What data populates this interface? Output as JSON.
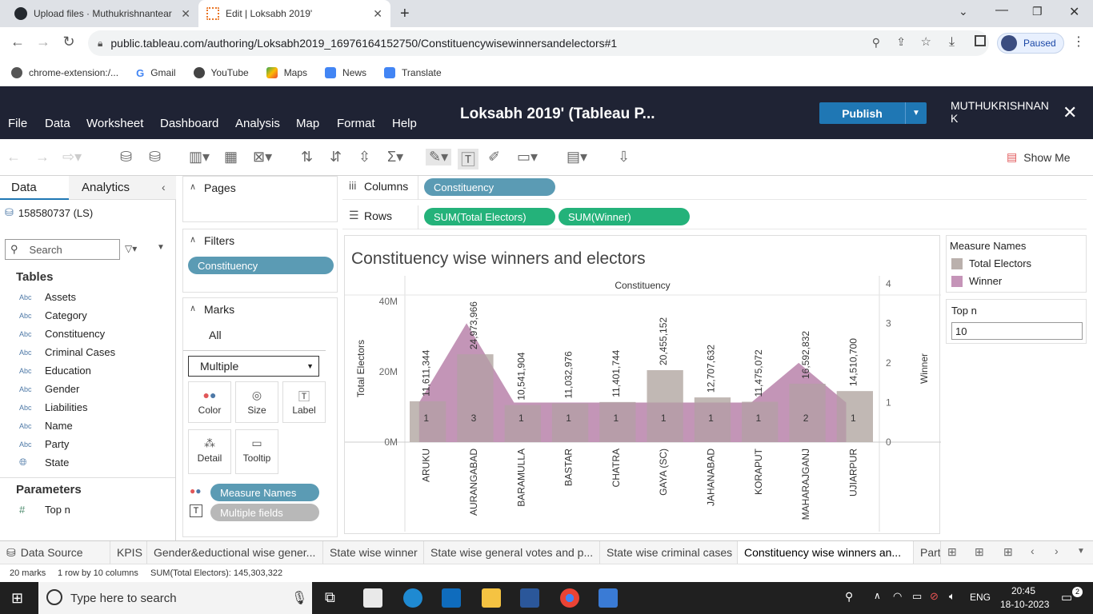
{
  "browser": {
    "tabs": [
      {
        "title": "Upload files · Muthukrishnantear",
        "active": false
      },
      {
        "title": "Edit | Loksabh 2019'",
        "active": true
      }
    ],
    "url": "public.tableau.com/authoring/Loksabh2019_16976164152750/Constituencywisewinnersandelectors#1",
    "profile_status": "Paused",
    "bookmarks": [
      "chrome-extension:/...",
      "Gmail",
      "YouTube",
      "Maps",
      "News",
      "Translate"
    ]
  },
  "tableau": {
    "menu": [
      "File",
      "Data",
      "Worksheet",
      "Dashboard",
      "Analysis",
      "Map",
      "Format",
      "Help"
    ],
    "workbook_title": "Loksabh 2019' (Tableau P...",
    "publish_label": "Publish",
    "user_line1": "MUTHUKRISHNAN",
    "user_line2": "K",
    "show_me": "Show Me"
  },
  "datapane": {
    "tab_data": "Data",
    "tab_analytics": "Analytics",
    "datasource": "158580737 (LS)",
    "search_placeholder": "Search",
    "tables_heading": "Tables",
    "type_abc": "Abc",
    "fields": [
      "Assets",
      "Category",
      "Constituency",
      "Criminal Cases",
      "Education",
      "Gender",
      "Liabilities",
      "Name",
      "Party",
      "State"
    ],
    "parameters_heading": "Parameters",
    "parameters": [
      "Top n"
    ]
  },
  "shelves": {
    "pages": "Pages",
    "filters": "Filters",
    "filter_pill": "Constituency",
    "marks": "Marks",
    "marks_all": "All",
    "mark_type": "Multiple",
    "mark_buttons": [
      "Color",
      "Size",
      "Label",
      "Detail",
      "Tooltip"
    ],
    "mark_pill_1": "Measure Names",
    "mark_pill_2": "Multiple fields",
    "columns_label": "Columns",
    "rows_label": "Rows",
    "columns_pill": "Constituency",
    "rows_pills": [
      "SUM(Total Electors)",
      "SUM(Winner)"
    ]
  },
  "legend": {
    "title": "Measure Names",
    "items": [
      {
        "label": "Total Electors",
        "color": "#bab0ac"
      },
      {
        "label": "Winner",
        "color": "#c594b8"
      }
    ]
  },
  "parameter_card": {
    "title": "Top n",
    "value": "10"
  },
  "chart_data": {
    "type": "bar",
    "title": "Constituency wise winners and electors",
    "xlabel": "Constituency",
    "ylabel": "Total Electors",
    "y2label": "Winner",
    "categories": [
      "ARUKU",
      "AURANGABAD",
      "BARAMULLA",
      "BASTAR",
      "CHATRA",
      "GAYA (SC)",
      "JAHANABAD",
      "KORAPUT",
      "MAHARAJGANJ",
      "UJIARPUR"
    ],
    "y_ticks": [
      "40M",
      "20M",
      "0M"
    ],
    "y2_ticks": [
      "4",
      "3",
      "2",
      "1",
      "0"
    ],
    "ylim": [
      0,
      45000000
    ],
    "y2lim": [
      0,
      4.4
    ],
    "series": [
      {
        "name": "Total Electors",
        "type": "bar",
        "values": [
          11611344,
          24973966,
          10541904,
          11032976,
          11401744,
          20455152,
          12707632,
          11475072,
          16592832,
          14510700
        ],
        "labels": [
          "11,611,344",
          "24,973,966",
          "10,541,904",
          "11,032,976",
          "11,401,744",
          "20,455,152",
          "12,707,632",
          "11,475,072",
          "16,592,832",
          "14,510,700"
        ]
      },
      {
        "name": "Winner",
        "type": "area",
        "values": [
          1,
          3,
          1,
          1,
          1,
          1,
          1,
          1,
          2,
          1
        ],
        "labels": [
          "1",
          "3",
          "1",
          "1",
          "1",
          "1",
          "1",
          "1",
          "2",
          "1"
        ]
      }
    ]
  },
  "sheet_tabs": [
    "Data Source",
    "KPIS",
    "Gender&eductional wise gener...",
    "State wise winner",
    "State wise general votes and p...",
    "State wise criminal cases",
    "Constituency wise winners an...",
    "Part"
  ],
  "status": {
    "marks": "20 marks",
    "rows": "1 row by 10 columns",
    "sum": "SUM(Total Electors): 145,303,322"
  },
  "taskbar": {
    "search_placeholder": "Type here to search",
    "lang": "ENG",
    "time": "20:45",
    "date": "18-10-2023",
    "notif_count": "2"
  }
}
